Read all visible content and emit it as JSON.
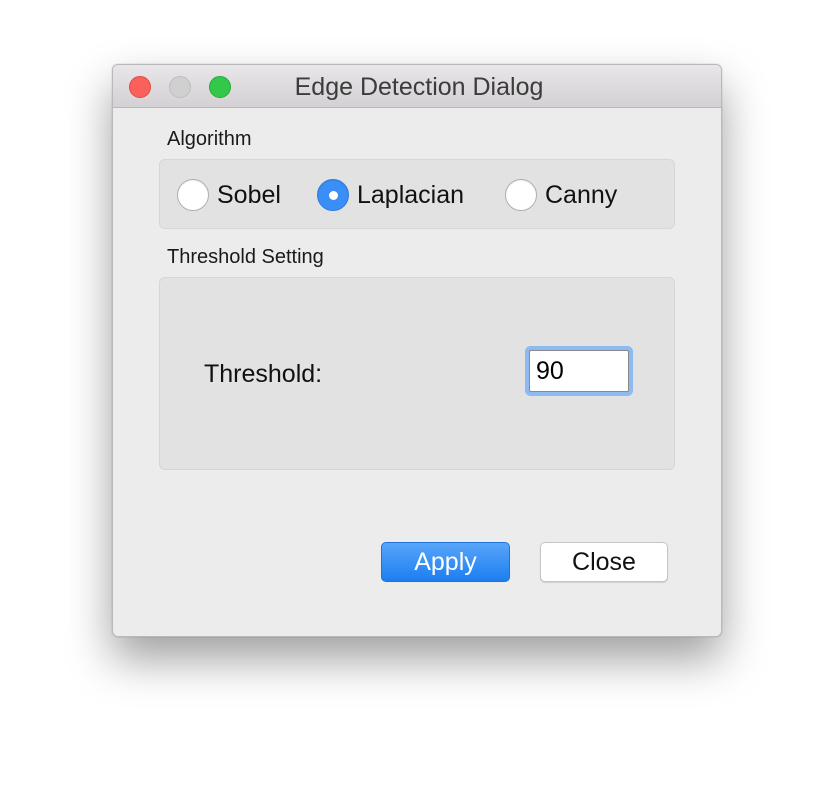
{
  "window": {
    "title": "Edge Detection Dialog"
  },
  "algorithm": {
    "label": "Algorithm",
    "options": [
      {
        "label": "Sobel",
        "selected": false
      },
      {
        "label": "Laplacian",
        "selected": true
      },
      {
        "label": "Canny",
        "selected": false
      }
    ]
  },
  "threshold": {
    "group_label": "Threshold Setting",
    "label": "Threshold:",
    "value": "90"
  },
  "buttons": {
    "apply": "Apply",
    "close": "Close"
  },
  "colors": {
    "accent": "#3a8ef6",
    "traffic_close": "#fc605c",
    "traffic_minimize": "#d0d0d0",
    "traffic_zoom": "#34c84a"
  }
}
